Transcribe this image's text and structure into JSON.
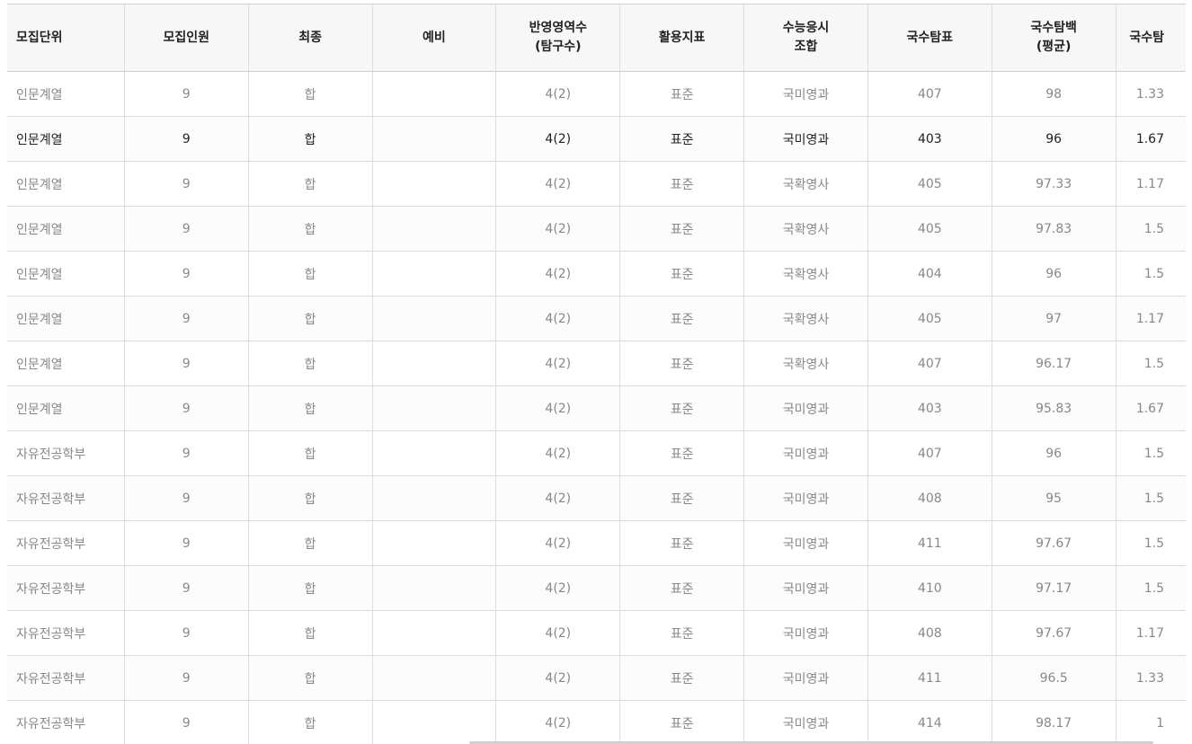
{
  "table": {
    "headers": [
      [
        "모집단위"
      ],
      [
        "모집인원"
      ],
      [
        "최종"
      ],
      [
        "예비"
      ],
      [
        "반영영역수",
        "(탐구수)"
      ],
      [
        "활용지표"
      ],
      [
        "수능응시",
        "조합"
      ],
      [
        "국수탐표"
      ],
      [
        "국수탐백",
        "(평균)"
      ],
      [
        "국수탐"
      ]
    ],
    "rows": [
      [
        "인문계열",
        "9",
        "합",
        "",
        "4(2)",
        "표준",
        "국미영과",
        "407",
        "98",
        "1.33"
      ],
      [
        "인문계열",
        "9",
        "합",
        "",
        "4(2)",
        "표준",
        "국미영과",
        "403",
        "96",
        "1.67"
      ],
      [
        "인문계열",
        "9",
        "합",
        "",
        "4(2)",
        "표준",
        "국확영사",
        "405",
        "97.33",
        "1.17"
      ],
      [
        "인문계열",
        "9",
        "합",
        "",
        "4(2)",
        "표준",
        "국확영사",
        "405",
        "97.83",
        "1.5"
      ],
      [
        "인문계열",
        "9",
        "합",
        "",
        "4(2)",
        "표준",
        "국확영사",
        "404",
        "96",
        "1.5"
      ],
      [
        "인문계열",
        "9",
        "합",
        "",
        "4(2)",
        "표준",
        "국확영사",
        "405",
        "97",
        "1.17"
      ],
      [
        "인문계열",
        "9",
        "합",
        "",
        "4(2)",
        "표준",
        "국확영사",
        "407",
        "96.17",
        "1.5"
      ],
      [
        "인문계열",
        "9",
        "합",
        "",
        "4(2)",
        "표준",
        "국미영과",
        "403",
        "95.83",
        "1.67"
      ],
      [
        "자유전공학부",
        "9",
        "합",
        "",
        "4(2)",
        "표준",
        "국미영과",
        "407",
        "96",
        "1.5"
      ],
      [
        "자유전공학부",
        "9",
        "합",
        "",
        "4(2)",
        "표준",
        "국미영과",
        "408",
        "95",
        "1.5"
      ],
      [
        "자유전공학부",
        "9",
        "합",
        "",
        "4(2)",
        "표준",
        "국미영과",
        "411",
        "97.67",
        "1.5"
      ],
      [
        "자유전공학부",
        "9",
        "합",
        "",
        "4(2)",
        "표준",
        "국미영과",
        "410",
        "97.17",
        "1.5"
      ],
      [
        "자유전공학부",
        "9",
        "합",
        "",
        "4(2)",
        "표준",
        "국미영과",
        "408",
        "97.67",
        "1.17"
      ],
      [
        "자유전공학부",
        "9",
        "합",
        "",
        "4(2)",
        "표준",
        "국미영과",
        "411",
        "96.5",
        "1.33"
      ],
      [
        "자유전공학부",
        "9",
        "합",
        "",
        "4(2)",
        "표준",
        "국미영과",
        "414",
        "98.17",
        "1"
      ]
    ],
    "highlighted_row": 1
  },
  "colors": {
    "header_bg": "#f7f7f7",
    "text_dark": "#222222",
    "text_muted": "#888888",
    "border": "#dcdcdc"
  }
}
